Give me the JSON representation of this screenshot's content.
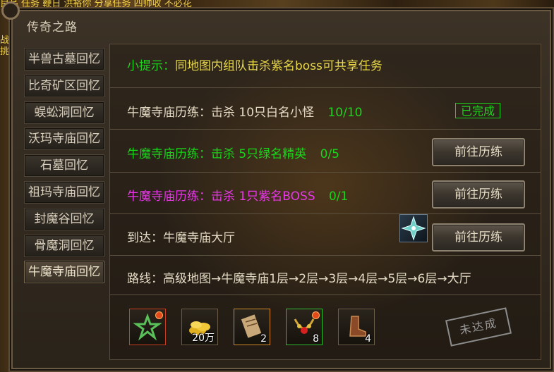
{
  "world": {
    "top_text": "良品 任务   鞭日   洪裕你   分享任务     四帅收    不必花",
    "side_text": "战 挑"
  },
  "window": {
    "title": "传奇之路"
  },
  "sidebar": {
    "items": [
      {
        "label": "半兽古墓回忆"
      },
      {
        "label": "比奇矿区回忆"
      },
      {
        "label": "蜈蚣洞回忆"
      },
      {
        "label": "沃玛寺庙回忆"
      },
      {
        "label": "石墓回忆"
      },
      {
        "label": "祖玛寺庙回忆"
      },
      {
        "label": "封魔谷回忆"
      },
      {
        "label": "骨魔洞回忆"
      },
      {
        "label": "牛魔寺庙回忆"
      }
    ],
    "active_index": 8
  },
  "tip": {
    "label": "小提示：",
    "text": "同地图内组队击杀紫名boss可共享任务",
    "color": "#e8d84a"
  },
  "tasks": [
    {
      "name": "牛魔寺庙历练：击杀 10只白名小怪",
      "progress": "10/10",
      "color": "#e6dcc6",
      "progress_color": "#1cd41c",
      "status": "已完成"
    },
    {
      "name": "牛魔寺庙历练：击杀 5只绿名精英",
      "progress": "0/5",
      "color": "#1cd41c",
      "progress_color": "#1cd41c",
      "button": "前往历练"
    },
    {
      "name": "牛魔寺庙历练：击杀 1只紫名BOSS",
      "progress": "0/1",
      "color": "#e838e8",
      "progress_color": "#1cd41c",
      "button": "前往历练"
    },
    {
      "name": "到达：牛魔寺庙大厅",
      "color": "#e6dcc6",
      "button": "前往历练"
    }
  ],
  "route": {
    "text": "路线：高级地图→牛魔寺庙1层→2层→3层→4层→5层→6层→大厅"
  },
  "rewards": [
    {
      "icon": "star-medal-icon",
      "count": "",
      "frame_color": "#c83c20",
      "has_dot": true
    },
    {
      "icon": "gold-coins-icon",
      "count": "20万",
      "frame_color": "#6b5c48",
      "has_dot": false
    },
    {
      "icon": "scroll-icon",
      "count": "2",
      "frame_color": "#d08a2a",
      "has_dot": false
    },
    {
      "icon": "gem-necklace-icon",
      "count": "8",
      "frame_color": "#2cbc2c",
      "has_dot": true
    },
    {
      "icon": "boots-icon",
      "count": "4",
      "frame_color": "#6b5c48",
      "has_dot": false
    }
  ],
  "stamp": {
    "text": "未达成"
  }
}
